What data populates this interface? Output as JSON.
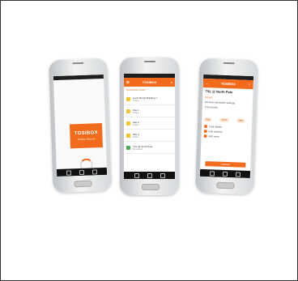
{
  "colors": {
    "brand": "#f26b1d",
    "text": "#333333"
  },
  "phone1": {
    "logo_title": "TOSIBOX",
    "logo_sub": "Tosibox Remote",
    "spinner_icon": "loading-spinner"
  },
  "phone2": {
    "app_title": "TOSIBOX",
    "section": "Accessible Locks",
    "items": [
      {
        "title": "Lock 312 @ Building 7",
        "sub": "Online",
        "status": "locked"
      },
      {
        "title": "Site 1",
        "sub": "Online",
        "status": "locked"
      },
      {
        "title": "Site 2",
        "sub": "Online",
        "status": "locked"
      },
      {
        "title": "Site 3",
        "sub": "Online",
        "status": "locked"
      },
      {
        "title": "TSL @ North Pole",
        "sub": "Connected",
        "status": "connected"
      }
    ]
  },
  "phone3": {
    "app_title": "TOSIBOX",
    "title": "TSL @ North Pole",
    "subtitle": "Details",
    "lines": [
      "Remote connection settings",
      "LAN access"
    ],
    "chips": [
      "Ping",
      "HTTP",
      "SSH"
    ],
    "entries": [
      "Lock details",
      "Sub network",
      "Add route"
    ],
    "button": "Connect"
  }
}
